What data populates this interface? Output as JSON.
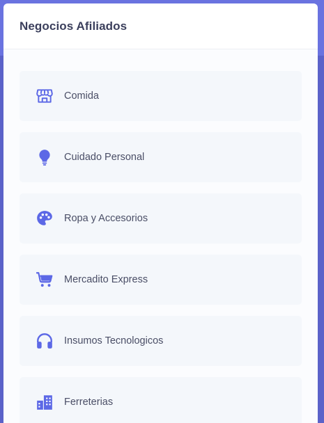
{
  "header": {
    "title": "Negocios Afiliados"
  },
  "accent": "#6a73e0",
  "icon_color": "#5c68e6",
  "items": [
    {
      "label": "Comida",
      "icon": "store-icon"
    },
    {
      "label": "Cuidado Personal",
      "icon": "lightbulb-icon"
    },
    {
      "label": "Ropa y Accesorios",
      "icon": "palette-icon"
    },
    {
      "label": "Mercadito Express",
      "icon": "shopping-cart-icon"
    },
    {
      "label": "Insumos Tecnologicos",
      "icon": "headphones-icon"
    },
    {
      "label": "Ferreterias",
      "icon": "buildings-icon"
    }
  ]
}
